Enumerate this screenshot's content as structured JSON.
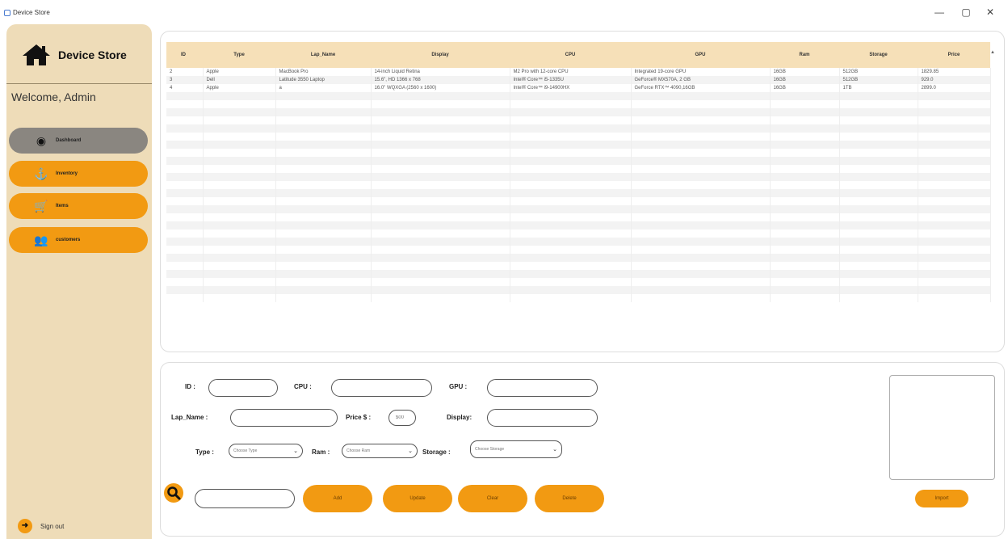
{
  "window": {
    "title": "Device Store",
    "controls": {
      "minimize": "—",
      "maximize": "▢",
      "close": "✕"
    }
  },
  "sidebar": {
    "brand": "Device Store",
    "brand_icon": "home-icon",
    "welcome": "Welcome, Admin",
    "items": [
      {
        "label": "Dashboard",
        "icon": "dashboard-icon",
        "glyph": "◉",
        "active": true
      },
      {
        "label": "Inventory",
        "icon": "anchor-icon",
        "glyph": "⚓",
        "active": false
      },
      {
        "label": "Items",
        "icon": "cart-icon",
        "glyph": "🛒",
        "active": false
      },
      {
        "label": "customers",
        "icon": "users-icon",
        "glyph": "👥",
        "active": false
      }
    ],
    "signout": "Sign out"
  },
  "table": {
    "columns": [
      "ID",
      "Type",
      "Lap_Name",
      "Display",
      "CPU",
      "GPU",
      "Ram",
      "Storage",
      "Price"
    ],
    "rows": [
      [
        "2",
        "Apple",
        "MacBook Pro",
        "14-inch Liquid Retina",
        "M2 Pro with 12-core CPU",
        "Integrated 19-core GPU",
        "16GB",
        "512GB",
        "1829.85"
      ],
      [
        "3",
        "Dell",
        "Latitude 3550 Laptop",
        "15.6\", HD 1366 x 768",
        "Intel® Core™ i5-1335U",
        "GeForce® MX570A, 2 GB",
        "16GB",
        "512GB",
        "929.0"
      ],
      [
        "4",
        "Apple",
        "a",
        "16.0\" WQXGA (2560 x 1600)",
        "Intel® Core™ i9-14900HX",
        "GeForce RTX™ 4090,16GB",
        "16GB",
        "1TB",
        "2899.0"
      ]
    ],
    "empty_rows": 26
  },
  "form": {
    "labels": {
      "id": "ID :",
      "cpu": "CPU :",
      "gpu": "GPU :",
      "lap_name": "Lap_Name :",
      "price": "Price $ :",
      "display": "Display:",
      "type": "Type :",
      "ram": "Ram :",
      "storage": "Storage :"
    },
    "price_placeholder": "$00",
    "selects": {
      "type": "Choose Type",
      "ram": "Choose Ram",
      "storage": "Choose Storage"
    },
    "buttons": {
      "add": "Add",
      "update": "Update",
      "clear": "Clear",
      "delete": "Delete",
      "import": "Import"
    }
  },
  "colors": {
    "sidebar_bg": "#eedcb8",
    "accent": "#f29a12",
    "active_nav": "#8a8680",
    "table_header": "#f6e0b8"
  }
}
